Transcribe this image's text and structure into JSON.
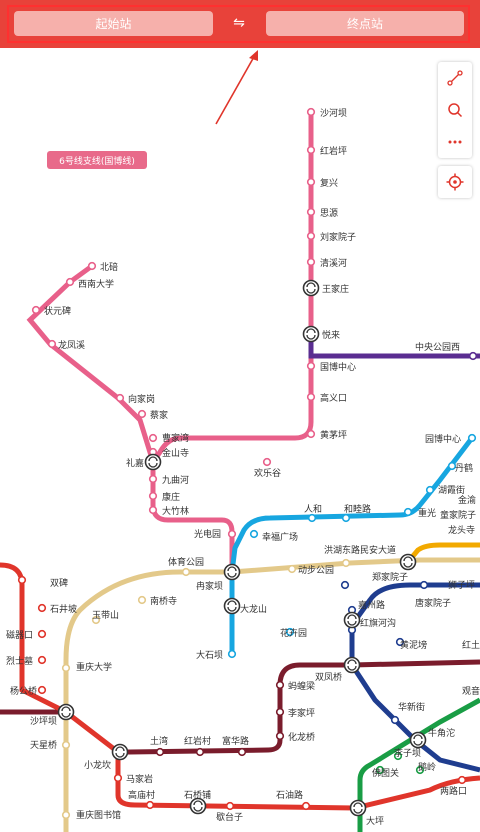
{
  "header": {
    "start_placeholder": "起始站",
    "end_placeholder": "终点站",
    "swap_symbol": "⇋"
  },
  "map_tag": "6号线支线(国博线)",
  "toolbar": {
    "items": [
      "route-icon",
      "search-icon",
      "more-icon"
    ],
    "locate": "locate-icon"
  },
  "colors": {
    "header": "#e8423a",
    "line1": "#e0352b",
    "line3": "#1f3d8f",
    "line6": "#e8608a",
    "line2": "#8a7c2e",
    "line4": "#d9a400",
    "line5": "#17a6e0",
    "line9": "#7a1c2c",
    "line10": "#5a2d91",
    "lineCream": "#e3c98a",
    "lineGreen": "#199d45"
  },
  "stations": {
    "shahe": "沙河坝",
    "hongyanping": "红岩坪",
    "fuxing": "复兴",
    "siyuan": "思源",
    "liujiayuanzi": "刘家院子",
    "qingxihe": "清溪河",
    "wangjiazhuang": "王家庄",
    "yuelai": "悦来",
    "guobo": "国博中心",
    "gaoyikou": "高义口",
    "huangmaoping": "黄茅坪",
    "zhongyang": "中央公园西",
    "beibei": "北碚",
    "xinan": "西南大学",
    "zhuangyuanbei": "状元碑",
    "longfengxi": "龙凤溪",
    "xiangjiagang": "向家岗",
    "caijia": "蔡家",
    "caojiawan": "曹家湾",
    "jinshansi": "金山寺",
    "lijia": "礼嘉",
    "huanlegu": "欢乐谷",
    "jiuquhe": "九曲河",
    "kangzhuang": "康庄",
    "dazhulin": "大竹林",
    "yuanbo": "园博中心",
    "danhe": "丹鹤",
    "huxiajie": "湖霞街",
    "jinyuan": "金渝",
    "tongjiayuanzi": "童家院子",
    "longtousi": "龙头寺",
    "renhe": "人和",
    "heshenglu": "和睦路",
    "chongguang": "重光",
    "guangdianyuan": "光电园",
    "xingfuguangchang": "幸福广场",
    "honghu": "洪湖东路民安大道",
    "tiyugongyuan": "体育公园",
    "zaijiaba": "冉家坝",
    "dongbugongyuan": "动步公园",
    "zhengjiayuanzi": "郑家院子",
    "shiziping": "狮子坪",
    "shuangbei": "双碑",
    "shijingpo": "石井坡",
    "yufushan": "玉带山",
    "nanqiaosi": "南桥寺",
    "dalongshan": "大龙山",
    "jiazhoulu": "嘉州路",
    "tangjiayuanzi": "唐家院子",
    "ciqikou": "磁器口",
    "liejimu": "烈士墓",
    "chongqingdaxue": "重庆大学",
    "huajiayuan": "花卉园",
    "hongqihegou": "红旗河沟",
    "huangnibang": "黄泥塝",
    "hongtu": "红土",
    "dashiba": "大石坝",
    "yangjiagongguan": "杨公桥",
    "shapingba": "沙坪坝",
    "shuangfengqiao": "双凤桥",
    "xiuyi": "蚂蝗梁",
    "lijiaping": "李家坪",
    "huatishan": "化龙桥",
    "huaxinjie": "华新街",
    "guanyinqiao": "观音桥",
    "niujiaotuo": "牛角沱",
    "tianxingqiao": "天星桥",
    "xiaolongkan": "小龙坎",
    "tuwan": "土湾",
    "hongyancun": "红岩村",
    "fuhualu": "富华路",
    "lizhiba": "李子坝",
    "fotuguan": "佛图关",
    "eling": "鹅岭",
    "majiayan": "马家岩",
    "gaomiaocun": "高庙村",
    "shibanzhen": "石桥铺",
    "shiyoulu": "石油路",
    "lianglukou": "两路口",
    "library": "重庆图书馆",
    "xiepingtai": "歇台子",
    "daping": "大坪"
  }
}
